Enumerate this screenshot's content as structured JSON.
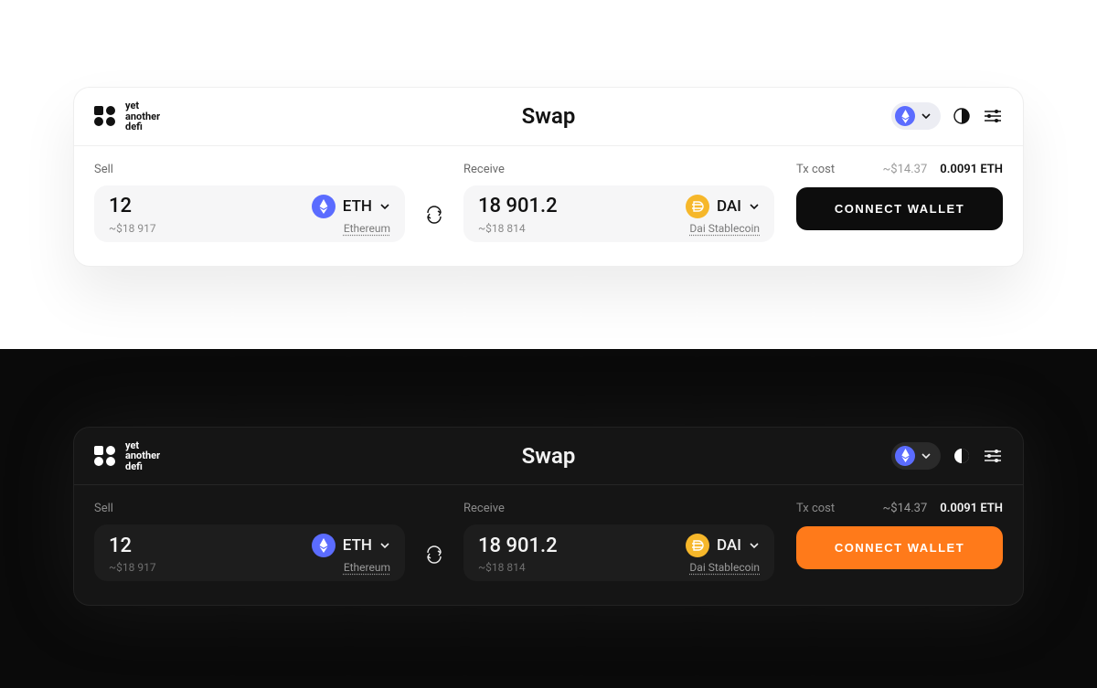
{
  "brand": {
    "line1": "yet",
    "line2": "another",
    "line3": "defi"
  },
  "title": "Swap",
  "network": {
    "symbol": "ETH"
  },
  "sell": {
    "label": "Sell",
    "amount": "12",
    "usd": "~$18 917",
    "token_symbol": "ETH",
    "token_name": "Ethereum"
  },
  "receive": {
    "label": "Receive",
    "amount": "18 901.2",
    "usd": "~$18 814",
    "token_symbol": "DAI",
    "token_name": "Dai Stablecoin"
  },
  "txcost": {
    "label": "Tx cost",
    "usd": "~$14.37",
    "native": "0.0091 ETH"
  },
  "cta": "CONNECT WALLET"
}
